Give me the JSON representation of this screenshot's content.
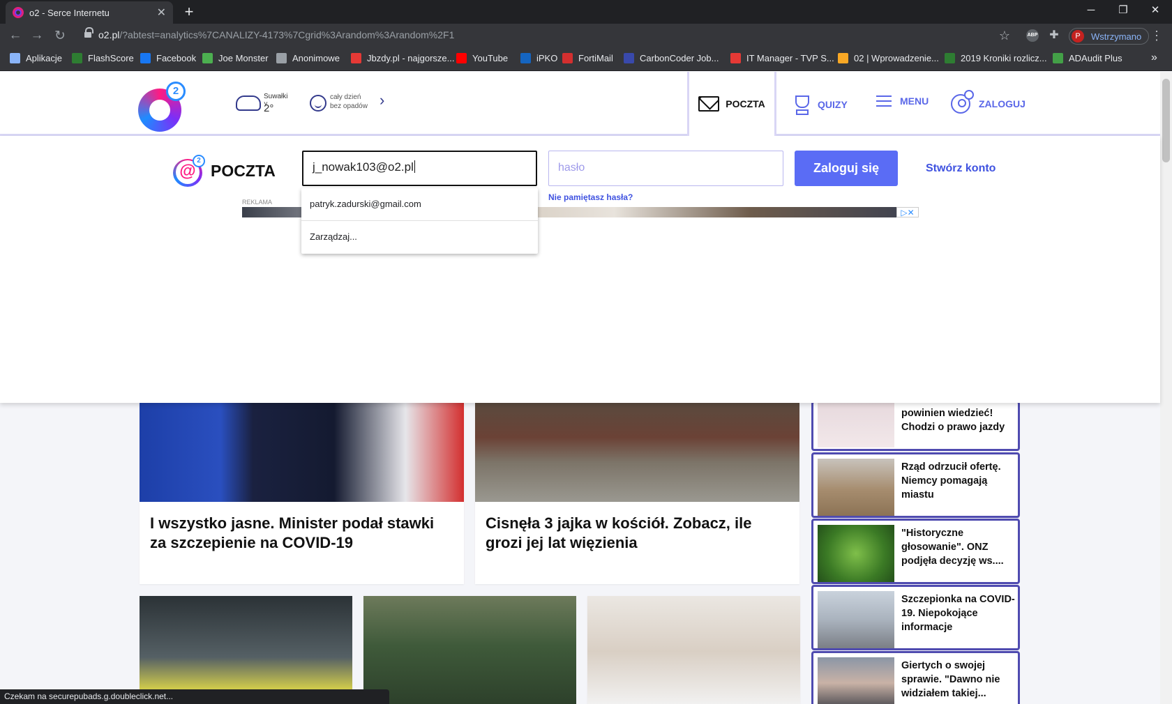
{
  "browser": {
    "tab_title": "o2 - Serce Internetu",
    "url_host": "o2.pl",
    "url_path": "/?abtest=analytics%7CANALIZY-4173%7Cgrid%3Arandom%3Arandom%2F1",
    "profile_initial": "P",
    "profile_status": "Wstrzymano",
    "bookmarks": [
      {
        "label": "Aplikacje",
        "color": "#8ab4f8"
      },
      {
        "label": "FlashScore",
        "color": "#2e7d32"
      },
      {
        "label": "Facebook",
        "color": "#1877f2"
      },
      {
        "label": "Joe Monster",
        "color": "#4caf50"
      },
      {
        "label": "Anonimowe",
        "color": "#9aa0a6"
      },
      {
        "label": "Jbzdy.pl - najgorsze...",
        "color": "#e53935"
      },
      {
        "label": "YouTube",
        "color": "#ff0000"
      },
      {
        "label": "iPKO",
        "color": "#1565c0"
      },
      {
        "label": "FortiMail",
        "color": "#d32f2f"
      },
      {
        "label": "CarbonCoder Job...",
        "color": "#3949ab"
      },
      {
        "label": "IT Manager - TVP S...",
        "color": "#e53935"
      },
      {
        "label": "02 | Wprowadzenie...",
        "color": "#f9a825"
      },
      {
        "label": "2019 Kroniki rozlicz...",
        "color": "#2e7d32"
      },
      {
        "label": "ADAudit Plus",
        "color": "#43a047"
      }
    ],
    "status_text": "Czekam na securepubads.g.doubleclick.net..."
  },
  "header": {
    "weather_city": "Suwałki",
    "weather_temp": "2°",
    "weather_desc_line1": "cały dzień",
    "weather_desc_line2": "bez opadów",
    "nav": {
      "poczta": "POCZTA",
      "quizy": "QUIZY",
      "menu": "MENU",
      "zaloguj": "ZALOGUJ"
    }
  },
  "login": {
    "title": "POCZTA",
    "email_value": "j_nowak103@o2.pl",
    "password_placeholder": "hasło",
    "login_button": "Zaloguj się",
    "create_account": "Stwórz konto",
    "forgot_password": "Nie pamiętasz hasła?",
    "ad_label": "REKLAMA",
    "autocomplete": [
      "patryk.zadurski@gmail.com",
      "Zarządzaj..."
    ]
  },
  "news": {
    "main": [
      {
        "title": "I wszystko jasne. Minister podał stawki za szczepienie na COVID-19"
      },
      {
        "title": "Cisnęła 3 jajka w kościół. Zobacz, ile grozi jej lat więzienia"
      }
    ],
    "sidebar": [
      {
        "title": "powinien wiedzieć! Chodzi o prawo jazdy"
      },
      {
        "title": "Rząd odrzucił ofertę. Niemcy pomagają miastu"
      },
      {
        "title": "\"Historyczne głosowanie\". ONZ podjęła decyzję ws...."
      },
      {
        "title": "Szczepionka na COVID-19. Niepokojące informacje"
      },
      {
        "title": "Giertych o swojej sprawie. \"Dawno nie widziałem takiej..."
      }
    ]
  }
}
